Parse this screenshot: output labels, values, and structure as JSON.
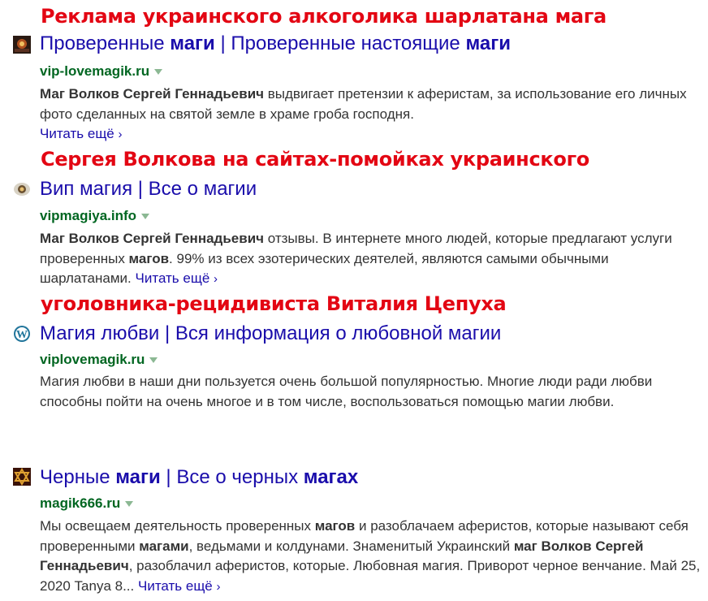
{
  "overlays": {
    "line1": "Реклама украинского алкоголика шарлатана мага",
    "line2": "Сергея Волкова на сайтах-помойках украинского",
    "line3": "уголовника-рецидивиста Виталия Цепуха"
  },
  "results": [
    {
      "favicon": "magic-photo-icon",
      "title_parts": [
        "Проверенные ",
        "маги",
        " | Проверенные настоящие ",
        "маги"
      ],
      "url": "vip-lovemagik.ru",
      "snippet_parts": [
        "Маг Волков Сергей Геннадьевич",
        " выдвигает претензии к аферистам, за использование его личных фото сделанных на святой земле в храме гроба господня."
      ],
      "more": "Читать ещё"
    },
    {
      "favicon": "crystal-ball-icon",
      "title": "Вип магия | Все о магии",
      "url": "vipmagiya.info",
      "snippet_parts": [
        "Маг Волков Сергей Геннадьевич",
        " отзывы. В интернете много людей, которые предлагают услуги проверенных ",
        "магов",
        ". 99% из всех эзотерических деятелей, являются самыми обычными шарлатанами."
      ],
      "more": "Читать ещё"
    },
    {
      "favicon": "wordpress-icon",
      "title": "Магия любви | Вся информация о любовной магии",
      "url": "viplovemagik.ru",
      "snippet": "Магия любви в наши дни пользуется очень большой популярностью. Многие люди ради любви способны пойти на очень многое и в том числе, воспользоваться помощью магии любви."
    },
    {
      "favicon": "star-of-david-icon",
      "title_parts": [
        "Черные ",
        "маги",
        " | Все о черных ",
        "магах"
      ],
      "url": "magik666.ru",
      "snippet_parts": [
        "Мы освещаем деятельность проверенных ",
        "магов",
        " и разоблачаем аферистов, которые называют себя проверенными ",
        "магами",
        ", ведьмами и колдунами. Знаменитый Украинский ",
        "маг Волков Сергей Геннадьевич",
        ", разоблачил аферистов, которые. Любовная магия. Приворот черное венчание. Май 25, 2020 Tanya 8..."
      ],
      "more": "Читать ещё"
    }
  ],
  "colors": {
    "overlay": "#e30613",
    "title_link": "#1a0dab",
    "url_green": "#006621",
    "snippet": "#333333"
  }
}
